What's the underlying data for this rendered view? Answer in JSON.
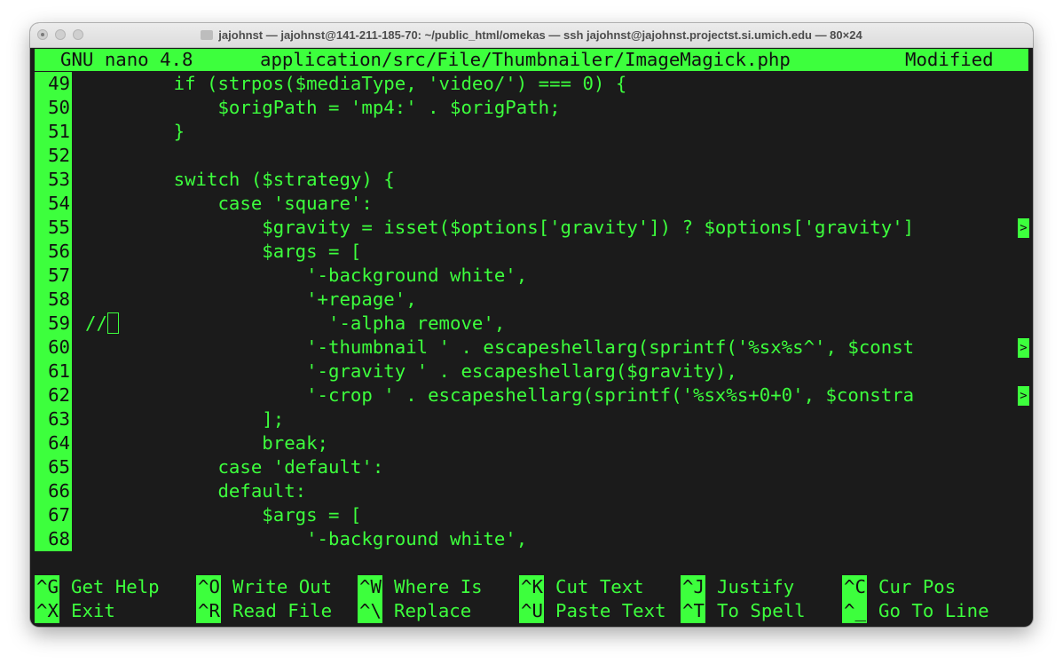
{
  "window": {
    "title": "jajohnst — jajohnst@141-211-185-70: ~/public_html/omekas — ssh jajohnst@jajohnst.projectst.si.umich.edu — 80×24"
  },
  "nano": {
    "version": "GNU nano 4.8",
    "file": "application/src/File/Thumbnailer/ImageMagick.php",
    "status": "Modified"
  },
  "lines": [
    {
      "num": "49",
      "text": "        if (strpos($mediaType, 'video/') === 0) {"
    },
    {
      "num": "50",
      "text": "            $origPath = 'mp4:' . $origPath;"
    },
    {
      "num": "51",
      "text": "        }"
    },
    {
      "num": "52",
      "text": ""
    },
    {
      "num": "53",
      "text": "        switch ($strategy) {"
    },
    {
      "num": "54",
      "text": "            case 'square':"
    },
    {
      "num": "55",
      "text": "                $gravity = isset($options['gravity']) ? $options['gravity']"
    },
    {
      "num": "56",
      "text": "                $args = ["
    },
    {
      "num": "57",
      "text": "                    '-background white',"
    },
    {
      "num": "58",
      "text": "                    '+repage',"
    },
    {
      "num": "59",
      "text": "                      '-alpha remove',",
      "prefix": "//"
    },
    {
      "num": "60",
      "text": "                    '-thumbnail ' . escapeshellarg(sprintf('%sx%s^', $const"
    },
    {
      "num": "61",
      "text": "                    '-gravity ' . escapeshellarg($gravity),"
    },
    {
      "num": "62",
      "text": "                    '-crop ' . escapeshellarg(sprintf('%sx%s+0+0', $constra"
    },
    {
      "num": "63",
      "text": "                ];"
    },
    {
      "num": "64",
      "text": "                break;"
    },
    {
      "num": "65",
      "text": "            case 'default':"
    },
    {
      "num": "66",
      "text": "            default:"
    },
    {
      "num": "67",
      "text": "                $args = ["
    },
    {
      "num": "68",
      "text": "                    '-background white',"
    }
  ],
  "more_marker": ">",
  "shortcuts": [
    {
      "key": "^G",
      "label": "Get Help"
    },
    {
      "key": "^O",
      "label": "Write Out"
    },
    {
      "key": "^W",
      "label": "Where Is"
    },
    {
      "key": "^K",
      "label": "Cut Text"
    },
    {
      "key": "^J",
      "label": "Justify"
    },
    {
      "key": "^C",
      "label": "Cur Pos"
    },
    {
      "key": "^X",
      "label": "Exit"
    },
    {
      "key": "^R",
      "label": "Read File"
    },
    {
      "key": "^\\",
      "label": "Replace"
    },
    {
      "key": "^U",
      "label": "Paste Text"
    },
    {
      "key": "^T",
      "label": "To Spell"
    },
    {
      "key": "^_",
      "label": "Go To Line"
    }
  ],
  "colors": {
    "foreground": "#3dff3d",
    "background": "#1b1b1b"
  }
}
